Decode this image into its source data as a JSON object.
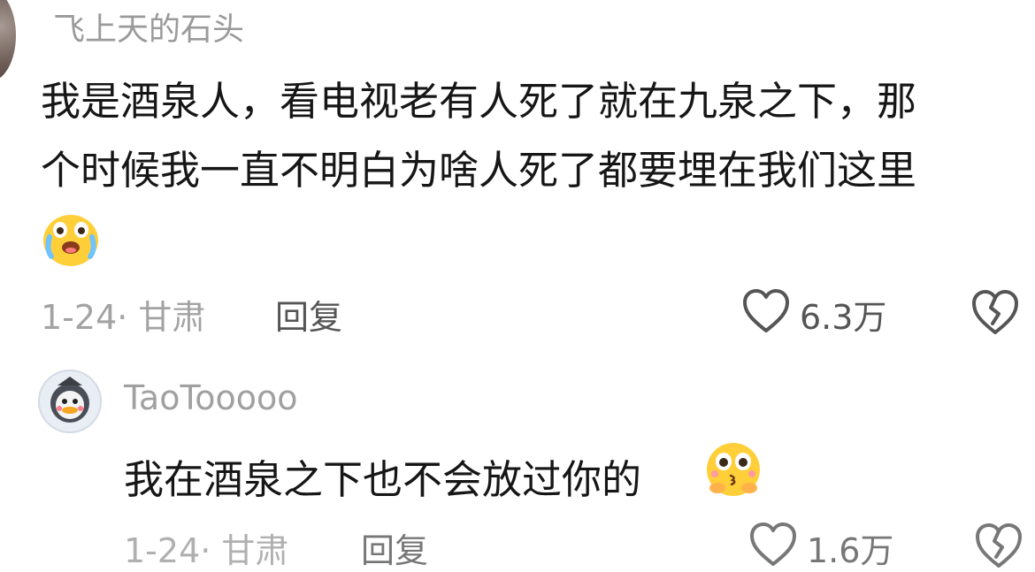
{
  "comment": {
    "username": "飞上天的石头",
    "text_line1": "我是酒泉人，看电视老有人死了就在九泉之下，那",
    "text_line2": "个时候我一直不明白为啥人死了都要埋在我们这里",
    "emoji_icon": "crying-face-icon",
    "date_location": "1-24· 甘肃",
    "reply_label": "回复",
    "likes": "6.3万",
    "like_icon": "heart-outline-icon",
    "dislike_icon": "broken-heart-icon"
  },
  "reply": {
    "username": "TaoTooooo",
    "avatar_icon": "duck-avatar-icon",
    "text": "我在酒泉之下也不会放过你的",
    "emoji_icon": "kiss-face-icon",
    "date_location": "1-24· 甘肃",
    "reply_label": "回复",
    "likes": "1.6万",
    "like_icon": "heart-outline-icon",
    "dislike_icon": "broken-heart-icon"
  },
  "colors": {
    "text": "#161616",
    "muted": "#a3a3a3",
    "action": "#555555",
    "emoji_yellow": "#ffcf3a"
  }
}
